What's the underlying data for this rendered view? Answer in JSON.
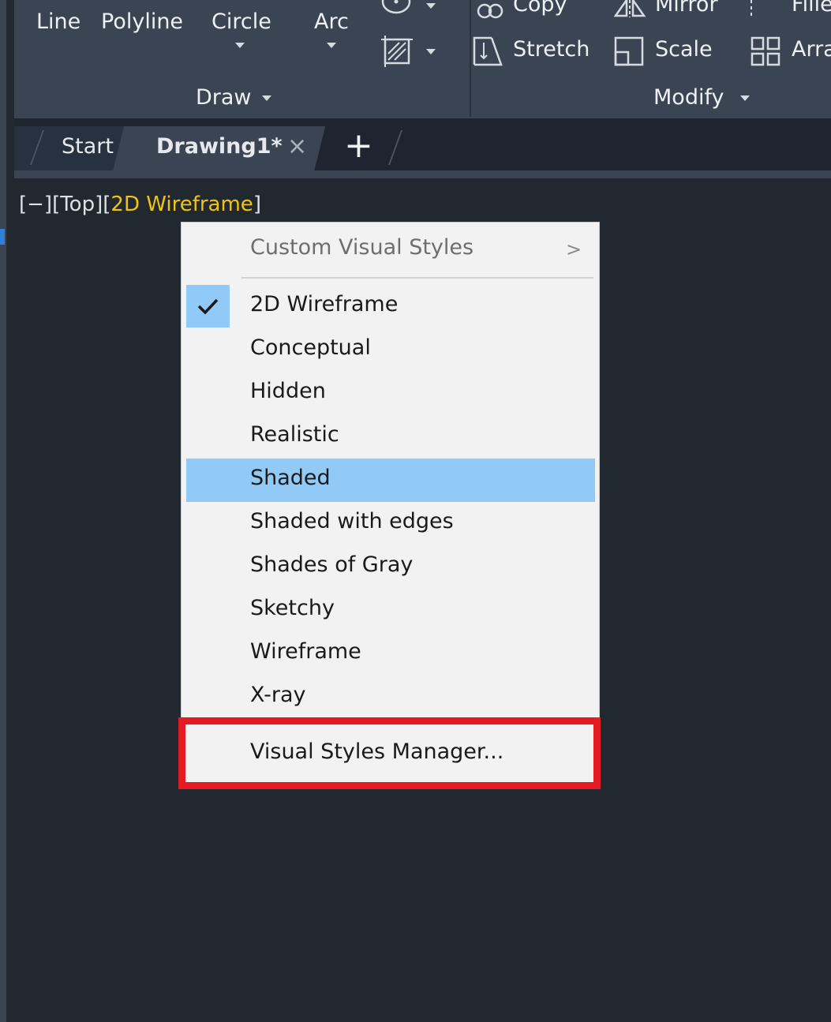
{
  "ribbon": {
    "draw_group": {
      "buttons": [
        "Line",
        "Polyline",
        "Circle",
        "Arc"
      ],
      "panel_label": "Draw"
    },
    "modify_group": {
      "row1": [
        "Copy",
        "Mirror",
        "Fille"
      ],
      "row2": [
        "Stretch",
        "Scale",
        "Arra"
      ],
      "panel_label": "Modify"
    }
  },
  "tabs": {
    "start": "Start",
    "active": "Drawing1*",
    "close_glyph": "×",
    "add_glyph": "+"
  },
  "viewport": {
    "minus": "[−]",
    "view": "[Top]",
    "style_open": "[",
    "style": "2D Wireframe",
    "style_close": "]"
  },
  "menu": {
    "submenu": "Custom Visual Styles",
    "submenu_chevron": ">",
    "items": [
      "2D Wireframe",
      "Conceptual",
      "Hidden",
      "Realistic",
      "Shaded",
      "Shaded with edges",
      "Shades of Gray",
      "Sketchy",
      "Wireframe",
      "X-ray"
    ],
    "checked": "2D Wireframe",
    "highlighted": "Shaded",
    "manager": "Visual Styles Manager..."
  },
  "colors": {
    "highlight": "#91c9f7",
    "annotation_red": "#e41b23",
    "viewport_style_yellow": "#f1c40f"
  }
}
